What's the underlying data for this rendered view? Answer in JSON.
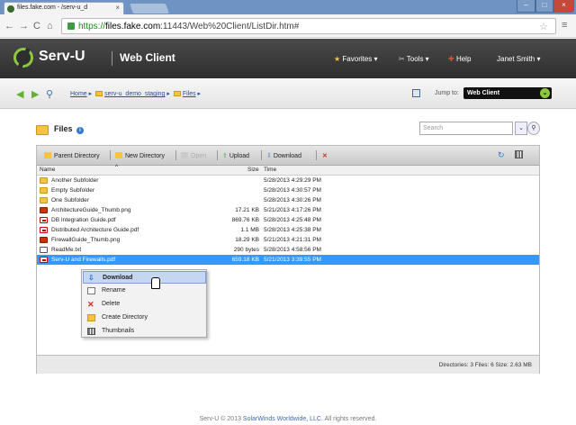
{
  "browser": {
    "tab_title": "files.fake.com - /serv-u_d",
    "tab_close": "×",
    "url_scheme": "https://",
    "url_host": "files.fake.com",
    "url_path": ":11443/Web%20Client/ListDir.htm#",
    "back": "←",
    "forward": "→",
    "reload": "C",
    "home": "⌂",
    "star": "☆",
    "menu": "≡",
    "win_min": "–",
    "win_max": "□",
    "win_close": "×"
  },
  "header": {
    "logo": "Serv-U",
    "product": "Web Client",
    "favorites": "Favorites ▾",
    "tools": "Tools ▾",
    "help": "Help",
    "user": "Janet Smith ▾"
  },
  "breadcrumb": {
    "home": "Home",
    "folder1": "serv-u_demo_staging",
    "folder2": "Files",
    "jump_label": "Jump to:",
    "jump_value": "Web Client"
  },
  "files": {
    "title": "Files",
    "search_placeholder": "Search"
  },
  "toolbar": {
    "parent": "Parent Directory",
    "new_dir": "New Directory",
    "open": "Open",
    "upload": "Upload",
    "download": "Download",
    "delete": "✕",
    "refresh": "↻"
  },
  "columns": {
    "name": "Name",
    "size": "Size",
    "time": "Time",
    "sort": "^"
  },
  "rows": [
    {
      "name": "Another Subfolder",
      "size": "",
      "time": "5/28/2013 4:29:29 PM",
      "type": "folder"
    },
    {
      "name": "Empty Subfolder",
      "size": "",
      "time": "5/28/2013 4:30:57 PM",
      "type": "folder"
    },
    {
      "name": "One Subfolder",
      "size": "",
      "time": "5/28/2013 4:30:26 PM",
      "type": "folder"
    },
    {
      "name": "ArchitectureGuide_Thumb.png",
      "size": "17.21 KB",
      "time": "5/21/2013 4:17:26 PM",
      "type": "png"
    },
    {
      "name": "DB Integration Guide.pdf",
      "size": "869.76 KB",
      "time": "5/28/2013 4:25:48 PM",
      "type": "pdf"
    },
    {
      "name": "Distributed Architecture Guide.pdf",
      "size": "1.1 MB",
      "time": "5/28/2013 4:25:38 PM",
      "type": "pdf"
    },
    {
      "name": "FirewallGuide_Thumb.png",
      "size": "18.29 KB",
      "time": "5/21/2013 4:21:31 PM",
      "type": "png"
    },
    {
      "name": "ReadMe.txt",
      "size": "290 bytes",
      "time": "5/28/2013 4:58:56 PM",
      "type": "txt"
    },
    {
      "name": "Serv-U and Firewalls.pdf",
      "size": "659.18 KB",
      "time": "5/21/2013 3:39:55 PM",
      "type": "pdf"
    }
  ],
  "context_menu": [
    "Download",
    "Rename",
    "Delete",
    "Create Directory",
    "Thumbnails"
  ],
  "status": "Directories: 3   Files: 6   Size: 2.63 MB",
  "footer": {
    "prefix": "Serv-U © 2013 ",
    "company": "SolarWinds Worldwide, LLC.",
    "suffix": " All rights reserved."
  }
}
